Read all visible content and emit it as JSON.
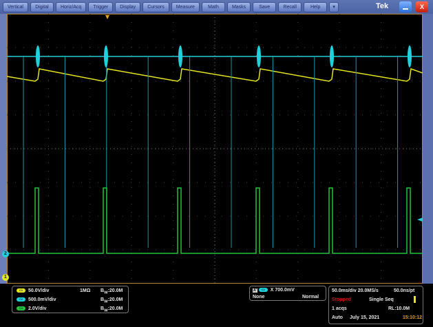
{
  "menu": {
    "items": [
      "Vertical",
      "Digital",
      "Horiz/Acq",
      "Trigger",
      "Display",
      "Cursors",
      "Measure",
      "Math",
      "Masks",
      "Save",
      "Recall",
      "Help"
    ],
    "more": "▾",
    "brand": "Tek",
    "close": "X"
  },
  "markers": {
    "ch2": "2",
    "ch1": "1"
  },
  "channels": [
    {
      "badge": "C1",
      "scale": "50.0V/div",
      "coupling": "1MΩ",
      "bw": "B",
      "bw_sub": "W",
      "bw_val": ":20.0M",
      "color": "#e6e61e"
    },
    {
      "badge": "C2",
      "scale": "500.0mV/div",
      "coupling": "",
      "bw": "B",
      "bw_sub": "W",
      "bw_val": ":20.0M",
      "color": "#22d0dc"
    },
    {
      "badge": "C4",
      "scale": "2.0V/div",
      "coupling": "",
      "bw": "B",
      "bw_sub": "W",
      "bw_val": ":20.0M",
      "color": "#22c43a"
    }
  ],
  "trigger": {
    "mode_icon": "A'",
    "source": "C2",
    "slope_icon": "X",
    "level": "700.0mV",
    "coupling": "None",
    "type": "Normal"
  },
  "acq": {
    "timebase": "50.0ms/div 20.0MS/s",
    "resolution": "50.0ns/pt",
    "state": "Stopped",
    "mode": "Single Seq",
    "acqs": "1 acqs",
    "rl": "RL:10.0M",
    "auto": "Auto",
    "date": "July 15, 2021",
    "time": "15:10:12",
    "state_color": "#d01010",
    "time_color": "#e0a020"
  }
}
